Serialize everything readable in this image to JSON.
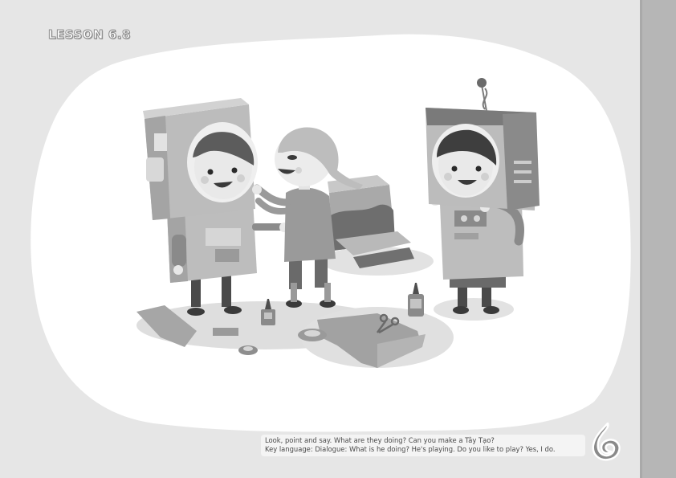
{
  "page": {
    "lesson_label": "LESSON 6.8",
    "instruction_line": "Look, point and say. What are they doing? Can you make a Tây Tạo?",
    "key_language_line": "Key language: Dialogue: What is he doing? He's playing. Do you like to play? Yes, I do."
  },
  "colors": {
    "background": "#e6e6e6",
    "side_bar": "#b6b6b6",
    "blob": "#ffffff",
    "illustration_light": "#d9d9d9",
    "illustration_mid": "#a8a8a8",
    "illustration_dark": "#5a5a5a"
  },
  "icons": [
    "book-series-logo-icon",
    "scissors-icon",
    "glue-bottle-icon",
    "tape-roll-icon"
  ]
}
